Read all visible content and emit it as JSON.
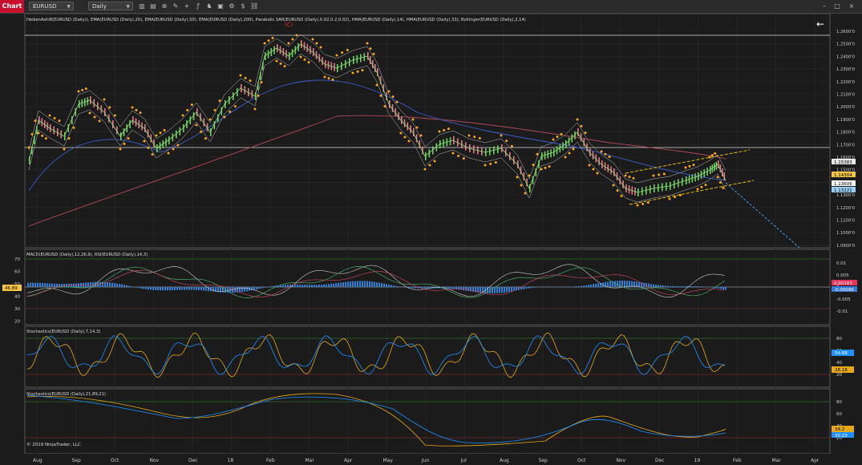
{
  "toolbar": {
    "chart_tab": "Chart",
    "instrument": "EURUSD",
    "interval": "Daily",
    "window_buttons": [
      "–",
      "□",
      "×"
    ]
  },
  "panels": {
    "price": {
      "indicator_label": "HeikenAshi8(EURUSD (Daily)), EMA(EURUSD (Daily),20), EMA(EURUSD (Daily),50), EMA(EURUSD (Daily),200), Parabolic SAR(EURUSD (Daily),0.02,0.2,0.02), HMA(EURUSD (Daily),14), HMA(EURUSD (Daily),33), Bollinger(EURUSD (Daily),2,14)",
      "wave_label": "(C)",
      "y_ticks": [
        "1.2600'0",
        "1.2500'0",
        "1.2400'0",
        "1.2300'0",
        "1.2200'0",
        "1.2100'0",
        "1.2000'0",
        "1.1900'0",
        "1.1800'0",
        "1.1700'0",
        "1.1600'0",
        "1.1500'0",
        "1.1400'0",
        "1.1300'0",
        "1.1200'0",
        "1.1100'0",
        "1.1000'0",
        "1.0900'0"
      ],
      "price_flags": [
        {
          "text": "1.15383",
          "color": "#e8e8e8",
          "fg": "#000000"
        },
        {
          "text": "1.14304",
          "color": "#f5c542",
          "fg": "#000000"
        },
        {
          "text": "1.13606",
          "color": "#ffffff",
          "fg": "#000000"
        },
        {
          "text": "1.13221",
          "color": "#9ad0f5",
          "fg": "#000000"
        }
      ]
    },
    "macd": {
      "indicator_label": "MACD(EURUSD (Daily),12,26,9), RSI(EURUSD (Daily),14,3)",
      "left_ticks": [
        "70",
        "60",
        "50",
        "40",
        "30",
        "20"
      ],
      "right_ticks": [
        "0.01",
        "0.005",
        "0",
        "-0.005",
        "-0.01"
      ],
      "rsi_flag": "46.89",
      "flags": [
        {
          "text": "0.00163",
          "color": "#e8335a"
        },
        {
          "text": "-0.00096",
          "color": "#3a78d8"
        }
      ]
    },
    "stoch1": {
      "indicator_label": "Stochastics(EURUSD (Daily),7,14,3)",
      "right_ticks": [
        "80",
        "60",
        "40",
        "20"
      ],
      "flags": [
        {
          "text": "54.68",
          "color": "#1e90ff"
        },
        {
          "text": "28.18",
          "color": "#e6a817"
        }
      ]
    },
    "stoch2": {
      "indicator_label": "Stochastics(EURUSD (Daily),21,89,21)",
      "right_ticks": [
        "80",
        "60",
        "40",
        "20"
      ],
      "flags": [
        {
          "text": "34.2",
          "color": "#e6a817"
        },
        {
          "text": "30.23",
          "color": "#1e90ff"
        }
      ],
      "copyright": "© 2019 NinjaTrader, LLC"
    }
  },
  "x_axis": [
    "Aug",
    "Sep",
    "Oct",
    "Nov",
    "Dec",
    "18",
    "Feb",
    "Mar",
    "Apr",
    "May",
    "Jun",
    "Jul",
    "Aug",
    "Sep",
    "Oct",
    "Nov",
    "Dec",
    "19",
    "Feb",
    "Mar",
    "Apr"
  ],
  "colors": {
    "background": "#1b1b1b",
    "sar_dots": "#f5a623",
    "ema200": "#b04a5a",
    "ema50": "#3f5fd0",
    "hma_fast": "#8ee07a",
    "trend_lines": "#f5d000",
    "projection": "#4aa3f0"
  }
}
